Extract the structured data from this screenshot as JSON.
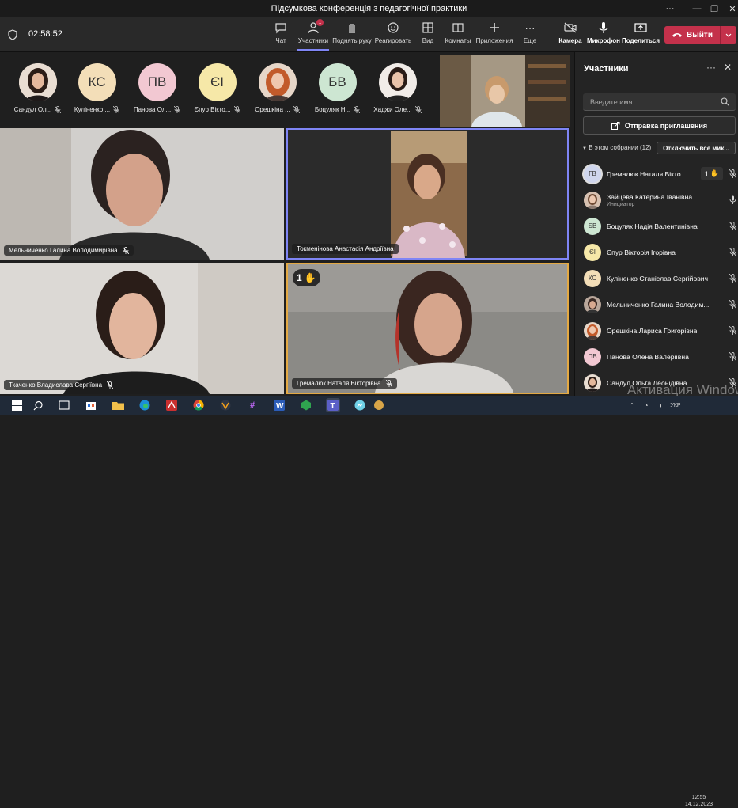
{
  "window": {
    "title": "Підсумкова конференція з педагогічної практики"
  },
  "toolbar": {
    "timer": "02:58:52",
    "buttons": [
      {
        "label": "Чат",
        "icon": "chat-icon"
      },
      {
        "label": "Участники",
        "icon": "people-icon",
        "badge": "1",
        "active": true
      },
      {
        "label": "Поднять руку",
        "icon": "raise-hand-icon"
      },
      {
        "label": "Реагировать",
        "icon": "react-icon"
      },
      {
        "label": "Вид",
        "icon": "view-icon"
      },
      {
        "label": "Комнаты",
        "icon": "rooms-icon"
      },
      {
        "label": "Приложения",
        "icon": "apps-icon"
      },
      {
        "label": "Еще",
        "icon": "more-icon"
      },
      {
        "label": "Камера",
        "icon": "camera-off-icon"
      },
      {
        "label": "Микрофон",
        "icon": "mic-icon"
      },
      {
        "label": "Поделиться",
        "icon": "share-icon"
      }
    ],
    "leave_label": "Выйти"
  },
  "avatars": [
    {
      "name": "Сандул Ол...",
      "initials": "",
      "color": "#d9c2b0"
    },
    {
      "name": "Кулiненко ...",
      "initials": "КС",
      "color": "#f3deb8"
    },
    {
      "name": "Панова Ол...",
      "initials": "ПВ",
      "color": "#f2c8d2"
    },
    {
      "name": "Єпур Вікто...",
      "initials": "ЄІ",
      "color": "#f6e8a8"
    },
    {
      "name": "Орешкіна ...",
      "initials": "",
      "color": "#d88a5a"
    },
    {
      "name": "Боцуляк Н...",
      "initials": "БВ",
      "color": "#cde6d2"
    },
    {
      "name": "Хаджи Оле...",
      "initials": "",
      "color": "#c8b3a7"
    }
  ],
  "tiles": [
    {
      "name": "Мельниченко Галина Володимирівна"
    },
    {
      "name": "Токменiнова Анастасія Андріївна"
    },
    {
      "name": "Ткаченко Владислава Сергіївна"
    },
    {
      "name": "Гремалюк Наталя Вікторівна",
      "hand": "1"
    }
  ],
  "panel": {
    "title": "Участники",
    "search_placeholder": "Введите имя",
    "invite_label": "Отправка приглашения",
    "section_label": "В этом собрании (12)",
    "mute_all_label": "Отключить все мик...",
    "participants": [
      {
        "name": "Гремалюк Наталя Вікто...",
        "initials": "ГВ",
        "color": "#cfd6ee",
        "hand": "1",
        "mic": "off"
      },
      {
        "name": "Зайцева Катерина Іванівна",
        "role": "Инициатор",
        "initials": "",
        "color": "#c9a98f",
        "mic": "on"
      },
      {
        "name": "Боцуляк Надія Валентинівна",
        "initials": "БВ",
        "color": "#cde6d2",
        "mic": "off"
      },
      {
        "name": "Єпур Вікторія Ігорівна",
        "initials": "ЄІ",
        "color": "#f6e8a8",
        "mic": "off"
      },
      {
        "name": "Кулiненко Станіслав Сергійович",
        "initials": "КС",
        "color": "#f3deb8",
        "mic": "off"
      },
      {
        "name": "Мельниченко Галина Володим...",
        "initials": "",
        "color": "#9c7a66",
        "mic": "off"
      },
      {
        "name": "Орешкіна Лариса Григорівна",
        "initials": "",
        "color": "#c7764a",
        "mic": "off"
      },
      {
        "name": "Панова Олена Валеріївна",
        "initials": "ПВ",
        "color": "#f2c8d2",
        "mic": "off"
      },
      {
        "name": "Сандул Ольга Леонідівна",
        "initials": "",
        "color": "#c9a98f",
        "mic": "off"
      }
    ]
  },
  "system": {
    "watermark": "Активация Windows",
    "time": "12:55",
    "date": "14.12.2023",
    "lang": "УКР"
  }
}
